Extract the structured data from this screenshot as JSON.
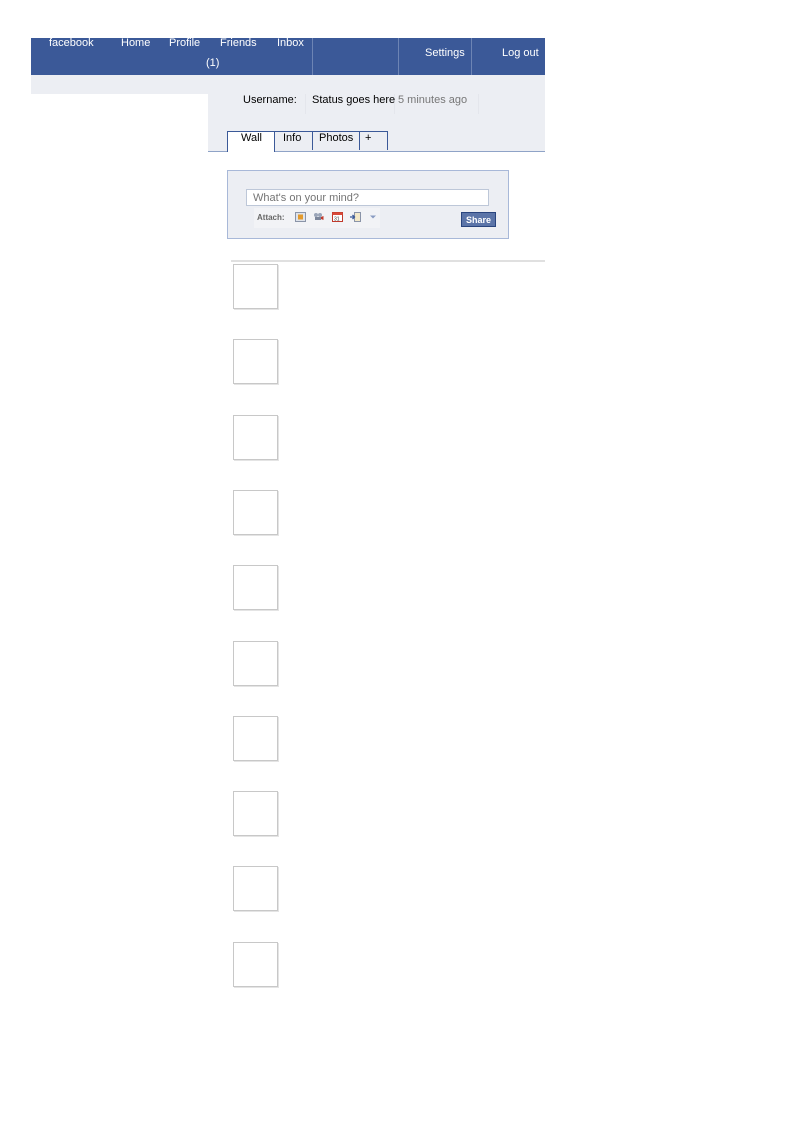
{
  "nav": {
    "logo": "facebook",
    "home": "Home",
    "profile": "Profile",
    "friends": "Friends",
    "inbox": "Inbox",
    "inbox_count": "(1)",
    "settings": "Settings",
    "logout": "Log out",
    "bg_color": "#3b5998"
  },
  "profile": {
    "username_label": "Username:",
    "status": "Status goes here",
    "time": "5 minutes ago"
  },
  "tabs": [
    {
      "label": "Wall",
      "active": true
    },
    {
      "label": "Info",
      "active": false
    },
    {
      "label": "Photos",
      "active": false
    },
    {
      "label": "+",
      "active": false
    }
  ],
  "publisher": {
    "placeholder": "What's on your mind?",
    "attach_label": "Attach:",
    "attach_icons": [
      "photo-icon",
      "video-icon",
      "event-icon",
      "link-icon",
      "dropdown-arrow-icon"
    ],
    "share_label": "Share"
  },
  "feed": {
    "post_count": 10
  }
}
